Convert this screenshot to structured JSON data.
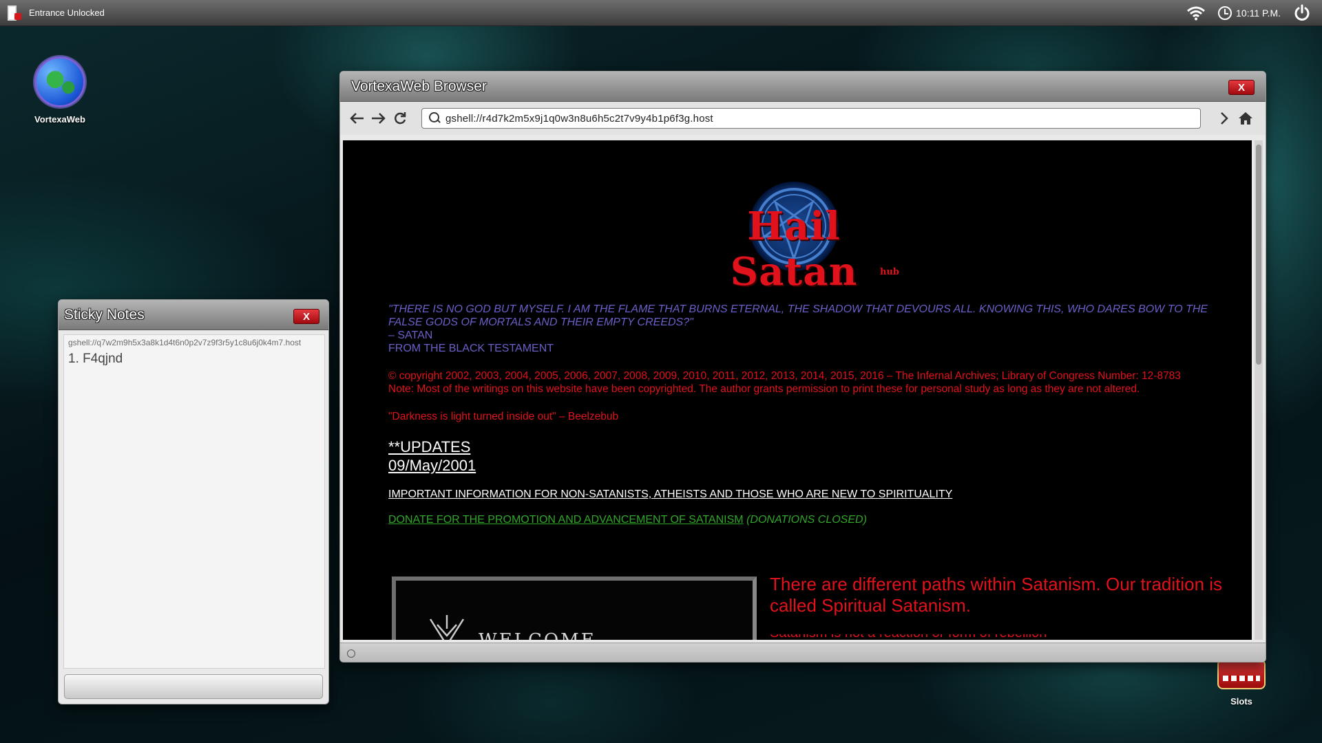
{
  "system_bar": {
    "status_text": "Entrance Unlocked",
    "time": "10:11 P.M.",
    "icons": [
      "door-lock-icon",
      "wifi-icon",
      "clock-icon",
      "power-icon"
    ]
  },
  "desktop": {
    "icons": [
      {
        "label": "VortexaWeb",
        "icon": "globe-icon"
      },
      {
        "label": "Slots",
        "icon": "slot-machine-icon"
      }
    ]
  },
  "browser": {
    "title": "VortexaWeb Browser",
    "close_label": "X",
    "url": "gshell://r4d7k2m5x9j1q0w3n8u6h5c2t7v9y4b1p6f3g.host",
    "nav_icons": [
      "back-arrow-icon",
      "forward-arrow-icon",
      "refresh-icon",
      "search-icon",
      "go-chevron-icon",
      "home-icon"
    ],
    "page": {
      "logo_text": "Hail Satan",
      "logo_sub": "hub",
      "quote": "\"THERE IS NO GOD BUT MYSELF. I AM THE FLAME THAT BURNS ETERNAL, THE SHADOW THAT DEVOURS ALL. KNOWING THIS, WHO DARES BOW TO THE FALSE GODS OF MORTALS AND THEIR EMPTY CREEDS?\"",
      "quote_author": "– SATAN",
      "quote_source": "FROM THE BLACK TESTAMENT",
      "copyright": "© copyright 2002, 2003, 2004, 2005, 2006, 2007, 2008, 2009, 2010, 2011, 2012, 2013, 2014, 2015, 2016 – The Infernal Archives; Library of Congress Number: 12-8783",
      "note": "Note: Most of the writings on this website have been copyrighted. The author grants permission to print these for personal study as long as they are not altered.",
      "darkness_quote": "\"Darkness is light turned inside out\" – Beelzebub",
      "updates_label": "**UPDATES",
      "updates_date": "09/May/2001",
      "info_link": "IMPORTANT INFORMATION FOR NON-SATANISTS, ATHEISTS AND THOSE WHO ARE NEW TO SPIRITUALITY",
      "donate_link": "DONATE FOR THE PROMOTION AND ADVANCEMENT OF SATANISM",
      "donate_status": "(DONATIONS CLOSED)",
      "welcome_heading": "WELCOME",
      "paths_text": "There are different paths within Satanism. Our tradition is called Spiritual Satanism.",
      "paths_more": "Satanism is not a reaction or form of rebellion"
    }
  },
  "sticky_notes": {
    "title": "Sticky Notes",
    "close_label": "X",
    "link_line": "gshell://q7w2m9h5x3a8k1d4t6n0p2v7z9f3r5y1c8u6j0k4m7.host",
    "entry": "1. F4qjnd"
  },
  "colors": {
    "accent_red": "#e1121c",
    "quote_purple": "#6a60c9",
    "link_green": "#30a829"
  }
}
